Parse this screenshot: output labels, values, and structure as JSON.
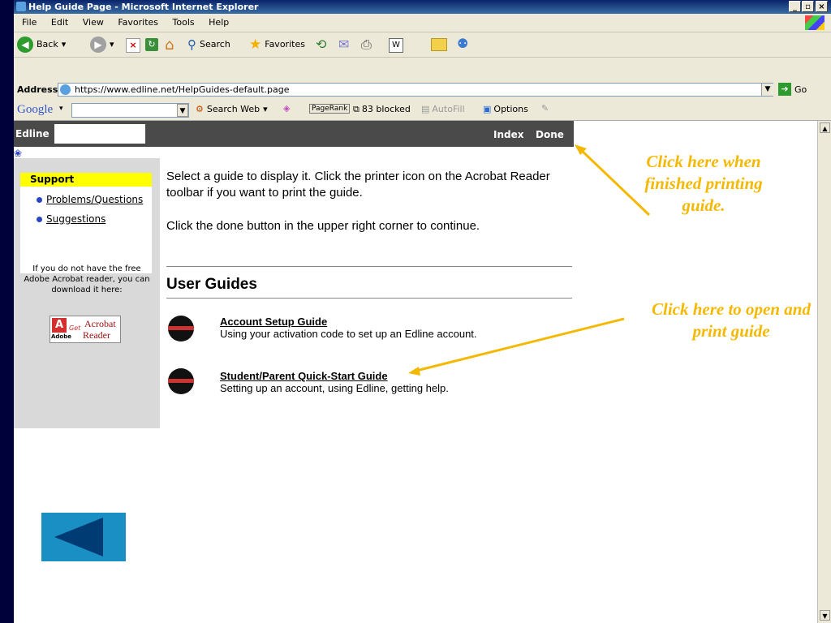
{
  "window": {
    "title": "Help Guide Page - Microsoft Internet Explorer",
    "controls": [
      "_",
      "▫",
      "×"
    ]
  },
  "menu": [
    "File",
    "Edit",
    "View",
    "Favorites",
    "Tools",
    "Help"
  ],
  "toolbar": {
    "back": "Back",
    "search": "Search",
    "favorites": "Favorites"
  },
  "address": {
    "label": "Address",
    "url": "https://www.edline.net/HelpGuides-default.page",
    "go": "Go"
  },
  "google": {
    "logo": "Google",
    "search_web": "Search Web",
    "pagerank": "PageRank",
    "blocked": "83 blocked",
    "autofill": "AutoFill",
    "options": "Options"
  },
  "edline": {
    "brand": "Edline",
    "index": "Index",
    "done": "Done"
  },
  "sidebar": {
    "support_title": "Support",
    "items": [
      "Problems/Questions",
      "Suggestions"
    ],
    "acrobat_note": "If you do not have the free Adobe Acrobat reader, you can download it here:",
    "acrobat_badge_get": "Get",
    "acrobat_badge_acrobat": "Acrobat",
    "acrobat_badge_reader": "Reader",
    "acrobat_badge_adobe": "Adobe"
  },
  "main": {
    "intro1": "Select a guide to display it. Click the printer icon on the Acrobat Reader toolbar if you want to print the guide.",
    "intro2": "Click the done button in the upper right corner to continue.",
    "section_title": "User Guides",
    "guides": [
      {
        "title": "Account Setup Guide",
        "desc": "Using your activation code to set up an Edline account."
      },
      {
        "title": "Student/Parent Quick-Start Guide",
        "desc": "Setting up an account, using Edline, getting help."
      }
    ]
  },
  "annotations": {
    "done_note": "Click here when finished printing guide.",
    "guide_note": "Click here to open and print guide"
  },
  "colors": {
    "annotation": "#f5b800",
    "back_button": "#1a8fc4",
    "back_arrow": "#003b73",
    "support_header": "#ffff00"
  }
}
